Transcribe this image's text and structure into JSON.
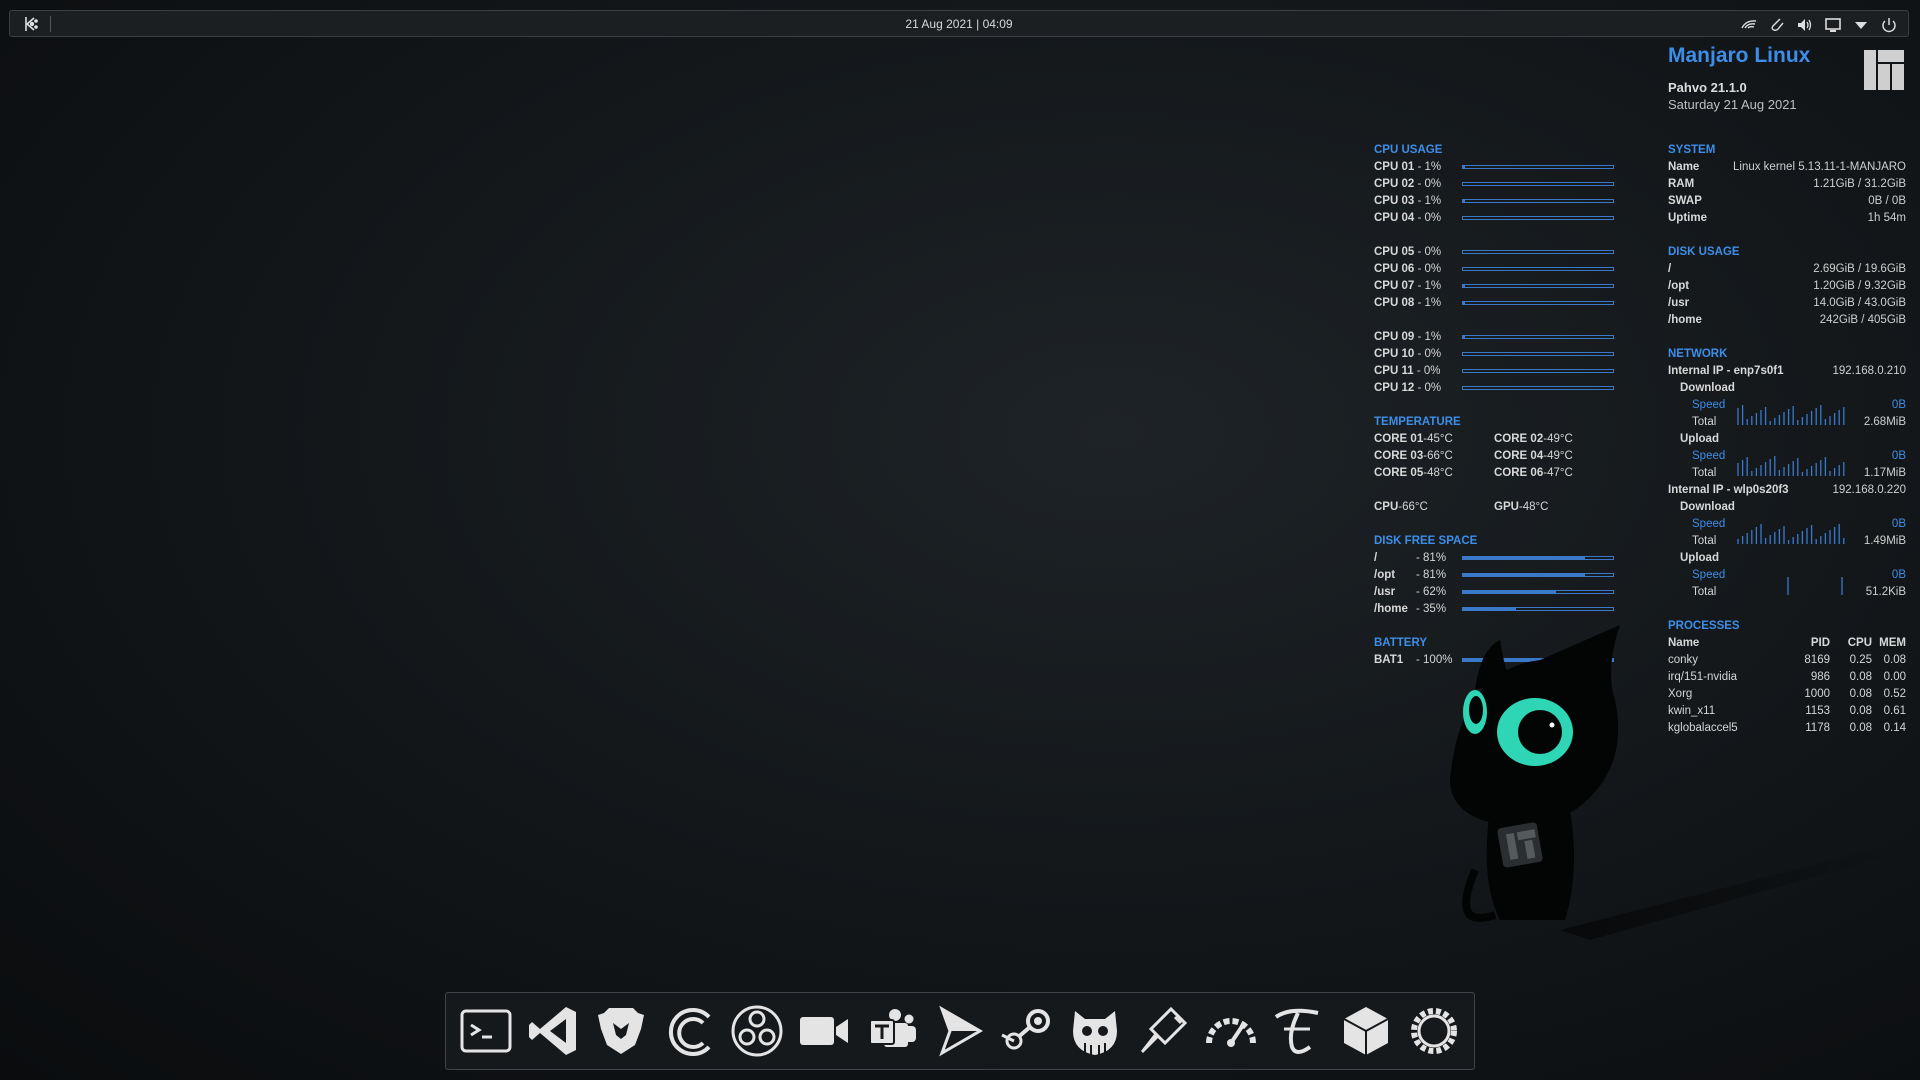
{
  "panel": {
    "clock": "21 Aug 2021 | 04:09",
    "tray_icons": [
      "kde-connect-icon",
      "clipboard-icon",
      "volume-icon",
      "display-icon",
      "expand-tray-icon",
      "power-icon"
    ]
  },
  "header": {
    "distro": "Manjaro Linux",
    "release": "Pahvo 21.1.0",
    "date": "Saturday 21 Aug 2021"
  },
  "cpu_usage": {
    "title": "CPU USAGE",
    "cores": [
      {
        "label": "CPU 01",
        "value": "1%",
        "pct": 1
      },
      {
        "label": "CPU 02",
        "value": "0%",
        "pct": 0
      },
      {
        "label": "CPU 03",
        "value": "1%",
        "pct": 1
      },
      {
        "label": "CPU 04",
        "value": "0%",
        "pct": 0
      },
      {
        "label": "CPU 05",
        "value": "0%",
        "pct": 0
      },
      {
        "label": "CPU 06",
        "value": "0%",
        "pct": 0
      },
      {
        "label": "CPU 07",
        "value": "1%",
        "pct": 1
      },
      {
        "label": "CPU 08",
        "value": "1%",
        "pct": 1
      },
      {
        "label": "CPU 09",
        "value": "1%",
        "pct": 1
      },
      {
        "label": "CPU 10",
        "value": "0%",
        "pct": 0
      },
      {
        "label": "CPU 11",
        "value": "0%",
        "pct": 0
      },
      {
        "label": "CPU 12",
        "value": "0%",
        "pct": 0
      }
    ]
  },
  "temperature": {
    "title": "TEMPERATURE",
    "rows": [
      [
        {
          "label": "CORE 01",
          "value": "45°C"
        },
        {
          "label": "CORE 02",
          "value": "49°C"
        }
      ],
      [
        {
          "label": "CORE 03",
          "value": "66°C"
        },
        {
          "label": "CORE 04",
          "value": "49°C"
        }
      ],
      [
        {
          "label": "CORE 05",
          "value": "48°C"
        },
        {
          "label": "CORE 06",
          "value": "47°C"
        }
      ]
    ],
    "summary": [
      {
        "label": "CPU",
        "value": "66°C"
      },
      {
        "label": "GPU",
        "value": "48°C"
      }
    ]
  },
  "disk_free": {
    "title": "DISK FREE SPACE",
    "items": [
      {
        "label": "/",
        "value": "81%",
        "pct": 81
      },
      {
        "label": "/opt",
        "value": "81%",
        "pct": 81
      },
      {
        "label": "/usr",
        "value": "62%",
        "pct": 62
      },
      {
        "label": "/home",
        "value": "35%",
        "pct": 35
      }
    ]
  },
  "battery": {
    "title": "BATTERY",
    "items": [
      {
        "label": "BAT1",
        "value": "100%",
        "pct": 100
      }
    ]
  },
  "system": {
    "title": "SYSTEM",
    "items": [
      {
        "label": "Name",
        "value": "Linux kernel 5.13.11-1-MANJARO"
      },
      {
        "label": "RAM",
        "value": "1.21GiB / 31.2GiB"
      },
      {
        "label": "SWAP",
        "value": "0B / 0B"
      },
      {
        "label": "Uptime",
        "value": "1h 54m"
      }
    ]
  },
  "disk_usage": {
    "title": "DISK USAGE",
    "items": [
      {
        "label": "/",
        "value": "2.69GiB / 19.6GiB"
      },
      {
        "label": "/opt",
        "value": "1.20GiB / 9.32GiB"
      },
      {
        "label": "/usr",
        "value": "14.0GiB / 43.0GiB"
      },
      {
        "label": "/home",
        "value": "242GiB / 405GiB"
      }
    ]
  },
  "network": {
    "title": "NETWORK",
    "download_label": "Download",
    "upload_label": "Upload",
    "speed_label": "Speed",
    "total_label": "Total",
    "interfaces": [
      {
        "label": "Internal IP - enp7s0f1",
        "ip": "192.168.0.210",
        "down": {
          "speed": "0B",
          "total": "2.68MiB"
        },
        "up": {
          "speed": "0B",
          "total": "1.17MiB"
        }
      },
      {
        "label": "Internal IP - wlp0s20f3",
        "ip": "192.168.0.220",
        "down": {
          "speed": "0B",
          "total": "1.49MiB"
        },
        "up": {
          "speed": "0B",
          "total": "51.2KiB"
        }
      }
    ]
  },
  "processes": {
    "title": "PROCESSES",
    "columns": [
      "Name",
      "PID",
      "CPU",
      "MEM"
    ],
    "rows": [
      [
        "conky",
        "8169",
        "0.25",
        "0.08"
      ],
      [
        "irq/151-nvidia",
        "986",
        "0.08",
        "0.00"
      ],
      [
        "Xorg",
        "1000",
        "0.08",
        "0.52"
      ],
      [
        "kwin_x11",
        "1153",
        "0.08",
        "0.61"
      ],
      [
        "kglobalaccel5",
        "1178",
        "0.08",
        "0.14"
      ]
    ]
  },
  "dock": {
    "apps": [
      "terminal-icon",
      "vscode-icon",
      "brave-icon",
      "celluloid-icon",
      "obs-icon",
      "video-camera-icon",
      "teams-icon",
      "play-icon",
      "steam-icon",
      "gitkraken-icon",
      "kolourpaint-icon",
      "system-monitor-icon",
      "typora-icon",
      "box-icon",
      "settings-icon"
    ]
  },
  "colors": {
    "accent": "#3d8ee8",
    "bar": "#3a79c9",
    "eye": "#2fd6b5"
  }
}
